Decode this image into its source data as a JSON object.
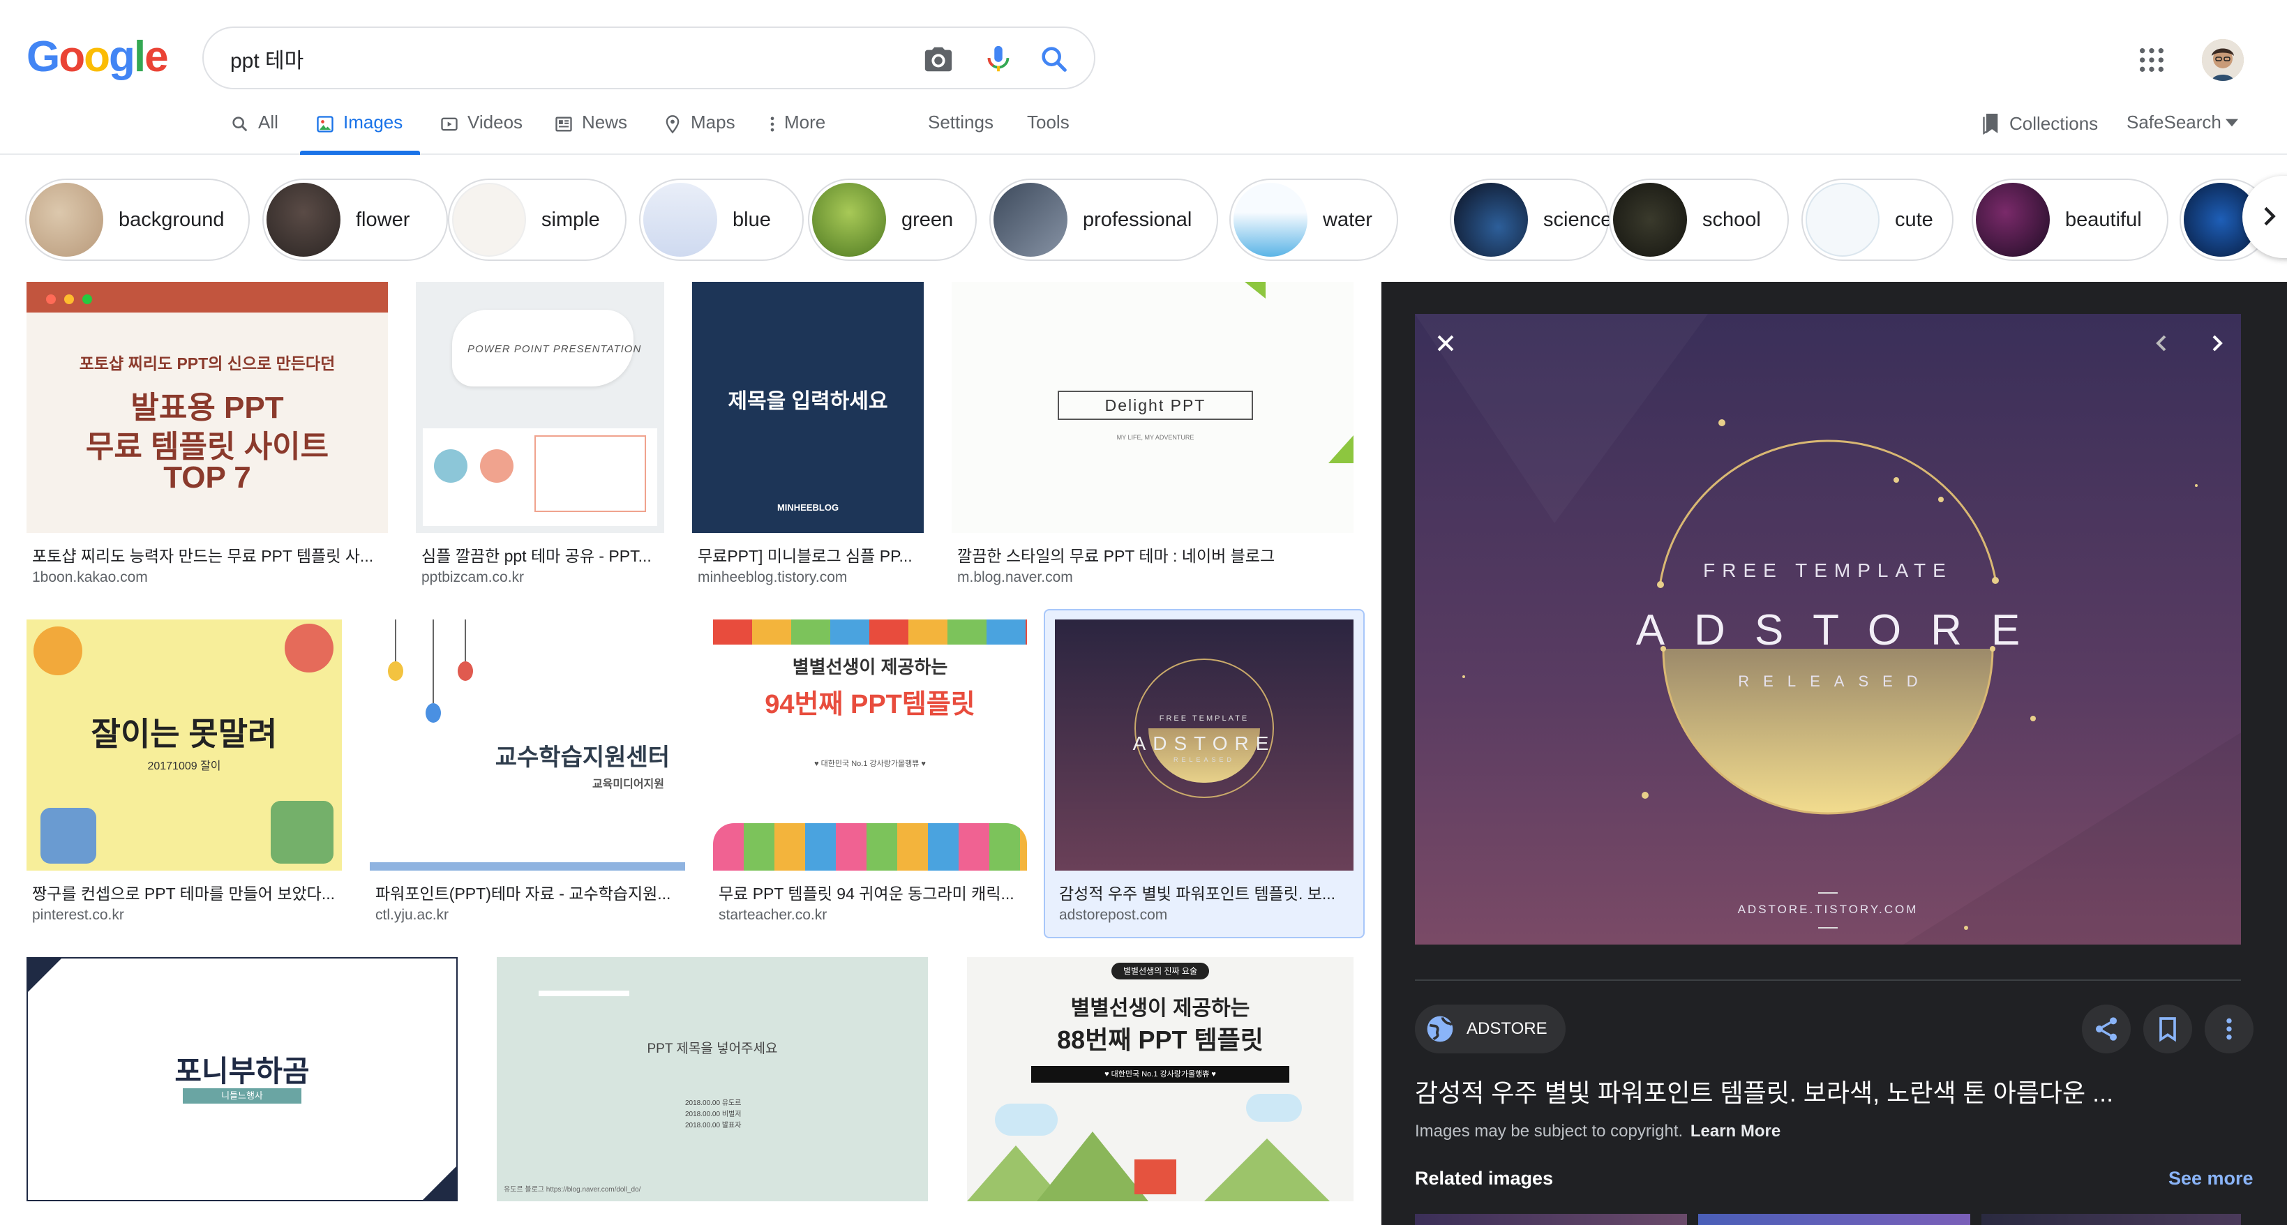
{
  "header": {
    "logo": [
      "G",
      "o",
      "o",
      "g",
      "l",
      "e"
    ],
    "logo_colors": [
      "#4285f4",
      "#ea4335",
      "#fbbc05",
      "#4285f4",
      "#34a853",
      "#ea4335"
    ],
    "search_value": "ppt 테마",
    "icons": [
      "camera-icon",
      "mic-icon",
      "search-icon",
      "apps-grid-icon"
    ]
  },
  "tabs": [
    {
      "label": "All",
      "icon": "search-icon"
    },
    {
      "label": "Images",
      "icon": "image-icon",
      "active": true
    },
    {
      "label": "Videos",
      "icon": "video-icon"
    },
    {
      "label": "News",
      "icon": "news-icon"
    },
    {
      "label": "Maps",
      "icon": "map-pin-icon"
    },
    {
      "label": "More",
      "icon": "more-vert-icon"
    }
  ],
  "tools": {
    "settings": "Settings",
    "tools": "Tools",
    "collections": "Collections",
    "safesearch": "SafeSearch"
  },
  "chips": [
    "background",
    "flower",
    "simple",
    "blue",
    "green",
    "professional",
    "water",
    "science",
    "school",
    "cute",
    "beautiful"
  ],
  "results": [
    {
      "title": "포토샵 찌리도 능력자 만드는 무료 PPT 템플릿 사...",
      "source": "1boon.kakao.com",
      "img_text": [
        "포토샵 찌리도 PPT의 신으로 만든다던",
        "발표용 PPT",
        "무료 템플릿 사이트",
        "TOP 7"
      ]
    },
    {
      "title": "심플 깔끔한 ppt 테마 공유 - PPT...",
      "source": "pptbizcam.co.kr",
      "img_text": [
        "POWER POINT PRESENTATION"
      ]
    },
    {
      "title": "무료PPT] 미니블로그 심플 PP...",
      "source": "minheeblog.tistory.com",
      "img_text": [
        "제목을 입력하세요",
        "MINHEEBLOG"
      ]
    },
    {
      "title": "깔끔한 스타일의 무료 PPT 테마 : 네이버 블로그",
      "source": "m.blog.naver.com",
      "img_text": [
        "Delight PPT",
        "MY LIFE, MY ADVENTURE"
      ]
    },
    {
      "title": "짱구를 컨셉으로 PPT 테마를 만들어 보았다...",
      "source": "pinterest.co.kr",
      "img_text": [
        "잘이는 못말려",
        "20171009 잘이"
      ]
    },
    {
      "title": "파워포인트(PPT)테마 자료 - 교수학습지원...",
      "source": "ctl.yju.ac.kr",
      "img_text": [
        "교수학습지원센터",
        "교육미디어지원"
      ]
    },
    {
      "title": "무료 PPT 템플릿 94 귀여운 동그라미 캐릭...",
      "source": "starteacher.co.kr",
      "img_text": [
        "별별선생이 제공하는",
        "94번째 PPT템플릿",
        "♥ 대한민국 No.1 강사랑가몰행쀼 ♥"
      ]
    },
    {
      "title": "감성적 우주 별빛 파워포인트 템플릿. 보...",
      "source": "adstorepost.com",
      "img_text": [
        "FREE TEMPLATE",
        "ADSTORE",
        "RELEASED"
      ]
    },
    {
      "img_text": [
        "포니부하곰",
        "니들느행사"
      ]
    },
    {
      "img_text": [
        "PPT 제목을 넣어주세요",
        "2018.00.00 유도르",
        "2018.00.00 비벌저",
        "2018.00.00 발표자",
        "유도르 블로그 https://blog.naver.com/doll_do/"
      ]
    },
    {
      "img_text": [
        "별별선생의 진짜 요술",
        "별별선생이 제공하는",
        "88번째 PPT 템플릿",
        "♥ 대한민국 No.1 강사랑가몰행쀼 ♥"
      ]
    }
  ],
  "panel": {
    "image_text": {
      "top": "FREE TEMPLATE",
      "main": "ADSTORE",
      "sub": "RELEASED",
      "url": "ADSTORE.TISTORY.COM"
    },
    "site_name": "ADSTORE",
    "title": "감성적 우주 별빛 파워포인트 템플릿. 보라색, 노란색 톤 아름다운 ...",
    "copyright": "Images may be subject to copyright.",
    "learn_more": "Learn More",
    "related": "Related images",
    "see_more": "See more",
    "icons": [
      "close-icon",
      "prev-icon",
      "next-icon",
      "share-icon",
      "bookmark-icon",
      "more-vert-icon"
    ]
  }
}
